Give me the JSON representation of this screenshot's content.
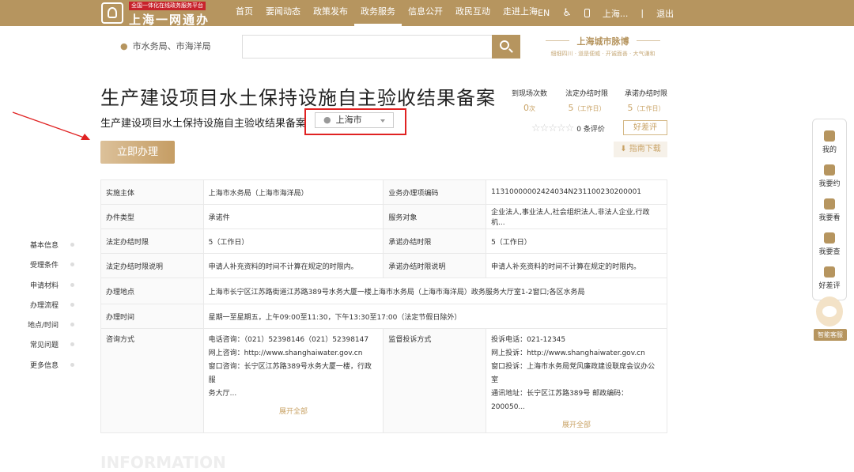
{
  "header": {
    "logo_tag": "全国一体化在线政务服务平台",
    "logo_title": "上海一网通办",
    "nav": [
      "首页",
      "要闻动态",
      "政策发布",
      "政务服务",
      "信息公开",
      "政民互动",
      "走进上海"
    ],
    "active_nav": "政务服务",
    "lang": "EN",
    "user": "上海...",
    "logout": "退出"
  },
  "location": {
    "text": "市水务局、市海洋局"
  },
  "search": {
    "placeholder": ""
  },
  "brand": {
    "title": "上海城市脉博",
    "subtitle": "细细四川 · 道是便威 · 开诚面善 · 大气谦和"
  },
  "service": {
    "title": "生产建设项目水土保持设施自主验收结果备案",
    "subtitle": "生产建设项目水土保持设施自主验收结果备案",
    "region": "上海市",
    "apply_label": "立即办理"
  },
  "stats": {
    "visits_label": "到现场次数",
    "visits_value": "0",
    "visits_unit": "次",
    "legal_label": "法定办结时限",
    "legal_value": "5",
    "legal_unit": "（工作日）",
    "promise_label": "承诺办结时限",
    "promise_value": "5",
    "promise_unit": "（工作日）",
    "rating_count": "0 条评价",
    "rating_button": "好差评",
    "guide_button": "指南下载"
  },
  "table": {
    "implement_k": "实施主体",
    "implement_v": "上海市水务局（上海市海洋局）",
    "code_k": "业务办理项编码",
    "code_v": "11310000002424034N231100230200001",
    "type_k": "办件类型",
    "type_v": "承诺件",
    "target_k": "服务对象",
    "target_v": "企业法人,事业法人,社会组织法人,非法人企业,行政机...",
    "legal_k": "法定办结时限",
    "legal_v": "5（工作日）",
    "promise_k": "承诺办结时限",
    "promise_v": "5（工作日）",
    "legal_note_k": "法定办结时限说明",
    "legal_note_v": "申请人补充资料的时间不计算在规定的时限内。",
    "promise_note_k": "承诺办结时限说明",
    "promise_note_v": "申请人补充资料的时间不计算在规定的时限内。",
    "place_k": "办理地点",
    "place_v": "上海市长宁区江苏路街道江苏路389号水务大厦一楼上海市水务局（上海市海洋局）政务服务大厅室1-2窗口;各区水务局",
    "time_k": "办理时间",
    "time_v": "星期一至星期五，上午09:00至11:30，下午13:30至17:00（法定节假日除外）",
    "consult_k": "咨询方式",
    "consult_lines": [
      "电话咨询：（021）52398146（021）52398147",
      "网上咨询：http://www.shanghaiwater.gov.cn",
      "窗口咨询：长宁区江苏路389号水务大厦一楼，行政服",
      "务大厅..."
    ],
    "complain_k": "监督投诉方式",
    "complain_lines": [
      "投诉电话：021-12345",
      "网上投诉：http://www.shanghaiwater.gov.cn",
      "窗口投诉：上海市水务局党风廉政建设联席会议办公室",
      "通讯地址：长宁区江苏路389号 邮政编码：200050..."
    ],
    "expand": "展开全部"
  },
  "sidenav": [
    "基本信息",
    "受理条件",
    "申请材料",
    "办理流程",
    "地点/时间",
    "常见问题",
    "更多信息"
  ],
  "float": [
    "我的",
    "我要约",
    "我要看",
    "我要查",
    "好差评"
  ],
  "smart_service": "智能客服",
  "bottom_ghost": "INFORMATION"
}
